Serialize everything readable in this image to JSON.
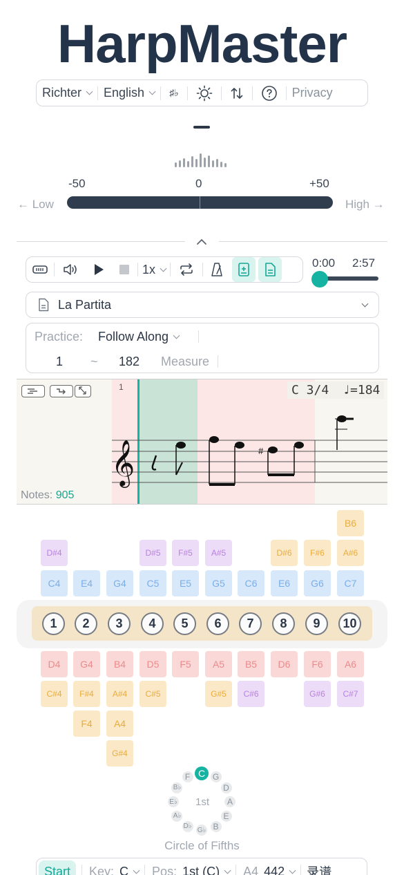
{
  "app": {
    "title": "HarpMaster"
  },
  "topbar": {
    "tuning": "Richter",
    "language": "English",
    "sharp_flat": "♯♭",
    "privacy": "Privacy"
  },
  "tuner": {
    "scale_min": "-50",
    "scale_mid": "0",
    "scale_max": "+50",
    "low_label": "← Low",
    "high_label": "High →"
  },
  "player": {
    "speed": "1x",
    "time_current": "0:00",
    "time_total": "2:57",
    "progress": 0.0
  },
  "song": {
    "name": "La Partita"
  },
  "practice": {
    "mode_label": "Practice:",
    "mode_value": "Follow Along",
    "measure_from": "1",
    "range_sep": "~",
    "measure_to": "182",
    "measure_label": "Measure"
  },
  "score": {
    "measure_number": "1",
    "key_time": "C 3/4",
    "tempo": "♩=184",
    "notes_label": "Notes:",
    "notes_count": "905"
  },
  "harp": {
    "blow_top": [
      {
        "label": "D#4",
        "color": "purple"
      },
      {
        "label": "D#5",
        "color": "purple"
      },
      {
        "label": "F#5",
        "color": "purple"
      },
      {
        "label": "A#5",
        "color": "purple"
      },
      {
        "label": "D#6",
        "color": "yellow"
      },
      {
        "label": "F#6",
        "color": "yellow"
      },
      {
        "label": "A#6",
        "color": "yellow"
      },
      {
        "label": "B6",
        "color": "yellow"
      }
    ],
    "blow": [
      "C4",
      "E4",
      "G4",
      "C5",
      "E5",
      "G5",
      "C6",
      "E6",
      "G6",
      "C7"
    ],
    "holes": [
      "1",
      "2",
      "3",
      "4",
      "5",
      "6",
      "7",
      "8",
      "9",
      "10"
    ],
    "draw": [
      "D4",
      "G4",
      "B4",
      "D5",
      "F5",
      "A5",
      "B5",
      "D6",
      "F6",
      "A6"
    ],
    "bends1": [
      {
        "label": "C#4",
        "color": "yellow"
      },
      {
        "label": "F#4",
        "color": "yellow"
      },
      {
        "label": "A#4",
        "color": "yellow"
      },
      {
        "label": "C#5",
        "color": "yellow"
      },
      {
        "label": "G#5",
        "color": "yellow"
      },
      {
        "label": "C#6",
        "color": "purple"
      },
      {
        "label": "G#6",
        "color": "purple"
      },
      {
        "label": "C#7",
        "color": "purple"
      }
    ],
    "bends2": [
      "F4",
      "A4"
    ],
    "bends3": [
      "G#4"
    ]
  },
  "circle_of_fifths": {
    "keys": [
      "C",
      "G",
      "D",
      "A",
      "E",
      "B",
      "G♭",
      "D♭",
      "A♭",
      "E♭",
      "B♭",
      "F"
    ],
    "selected": "C",
    "center": "1st",
    "label": "Circle of Fifths"
  },
  "bottombar": {
    "start": "Start",
    "key_label": "Key:",
    "key_value": "C",
    "pos_label": "Pos:",
    "pos_value": "1st (C)",
    "a4_label": "A4",
    "a4_value": "442",
    "record": "录谱"
  },
  "colors": {
    "accent": "#16b3a2",
    "title": "#23344a"
  }
}
